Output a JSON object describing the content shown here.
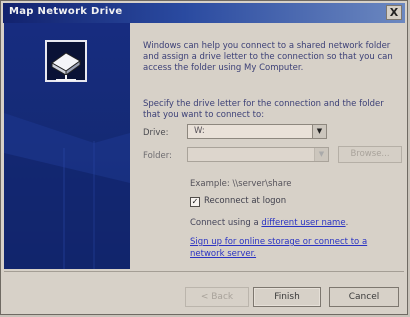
{
  "window": {
    "title": "Map Network Drive",
    "close_glyph": "X"
  },
  "intro_text": "Windows can help you connect to a shared network folder and assign a drive letter to the connection so that you can access the folder using My Computer.",
  "instruction_text": "Specify the drive letter for the connection and the folder that you want to connect to:",
  "drive": {
    "label": "Drive:",
    "value": "W:"
  },
  "folder": {
    "label": "Folder:",
    "value": "",
    "browse_label": "Browse..."
  },
  "example_text": "Example: \\\\server\\share",
  "reconnect": {
    "label": "Reconnect at logon",
    "checked": true,
    "check_glyph": "✓"
  },
  "connect_prefix": "Connect using a ",
  "connect_link": "different user name",
  "connect_suffix": ".",
  "signup_link": "Sign up for online storage or connect to a network server.",
  "buttons": {
    "back": "< Back",
    "finish": "Finish",
    "cancel": "Cancel"
  },
  "icons": [
    "network-drive-icon",
    "chevron-down-icon",
    "close-icon"
  ],
  "colors": {
    "title_bar": "#1b2f83",
    "side_panel": "#172c80",
    "dialog_bg": "#d7d1c8",
    "link": "#2a33c2"
  }
}
